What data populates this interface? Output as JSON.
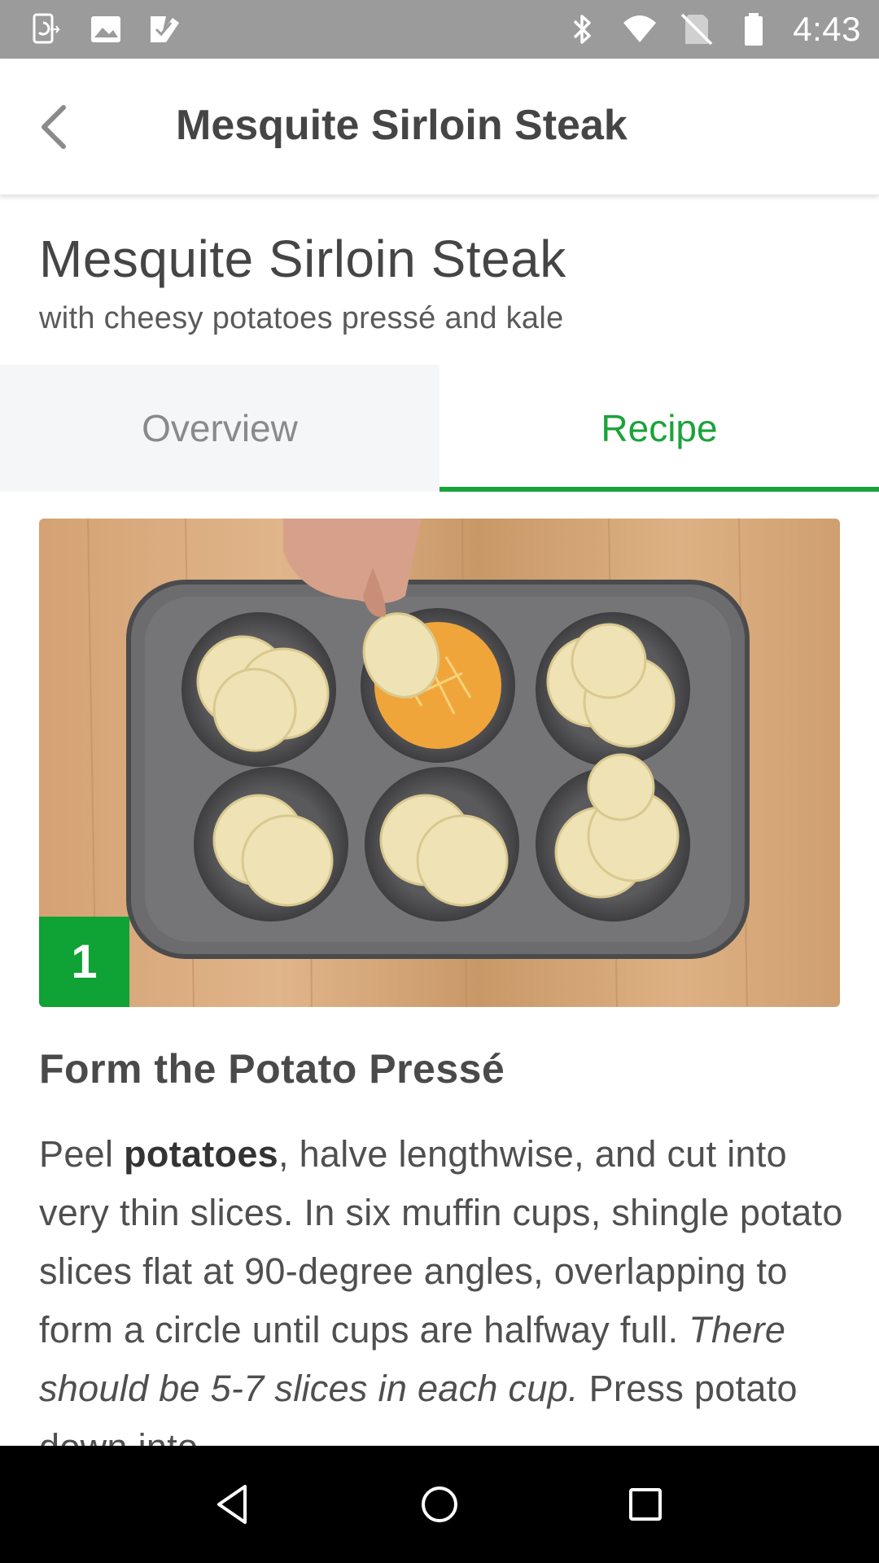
{
  "status_bar": {
    "time": "4:43",
    "left_icons": [
      "phone-sync-icon",
      "image-icon",
      "task-check-icon"
    ],
    "right_icons": [
      "bluetooth-icon",
      "wifi-icon",
      "no-sim-icon",
      "battery-icon"
    ]
  },
  "app_bar": {
    "title": "Mesquite Sirloin Steak",
    "back_icon": "chevron-left-icon"
  },
  "header": {
    "title": "Mesquite Sirloin Steak",
    "subtitle": "with cheesy potatoes pressé and kale"
  },
  "tabs": [
    {
      "label": "Overview",
      "active": false
    },
    {
      "label": "Recipe",
      "active": true
    }
  ],
  "step": {
    "number": "1",
    "title": "Form the Potato Pressé",
    "body": {
      "p1": "Peel ",
      "bold1": "potatoes",
      "p2": ", halve lengthwise, and cut into very thin slices. In six muffin cups, shingle potato slices flat at 90-degree angles, overlapping to form a circle until cups are halfway full.  ",
      "italic1": "There should be 5-7 slices in each cup.",
      "p3": " Press potato down into"
    }
  },
  "nav_bar": {
    "icons": [
      "back-triangle-icon",
      "home-circle-icon",
      "recents-square-icon"
    ]
  },
  "colors": {
    "accent": "#1aa33a",
    "status_bar": "#9b9b9b",
    "badge": "#0fa235"
  }
}
